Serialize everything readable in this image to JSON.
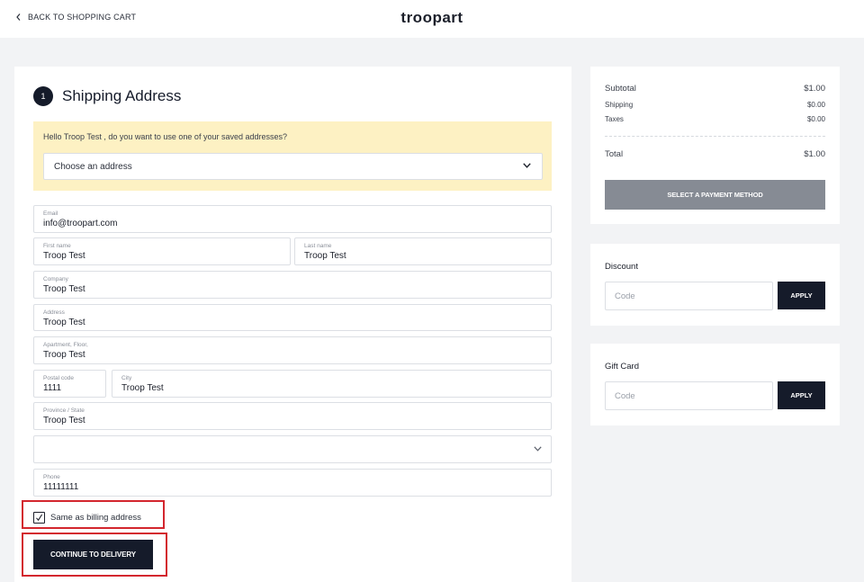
{
  "header": {
    "back_label": "BACK TO SHOPPING CART",
    "brand": "troopart"
  },
  "shipping": {
    "step_number": "1",
    "title": "Shipping Address",
    "saved_prompt": "Hello Troop Test , do you want to use one of your saved addresses?",
    "saved_select_value": "Choose an address",
    "fields": {
      "email": {
        "label": "Email",
        "value": "info@troopart.com"
      },
      "first_name": {
        "label": "First name",
        "value": "Troop Test"
      },
      "last_name": {
        "label": "Last name",
        "value": "Troop Test"
      },
      "company": {
        "label": "Company",
        "value": "Troop Test"
      },
      "address": {
        "label": "Address",
        "value": "Troop Test"
      },
      "apartment": {
        "label": "Apartment, Floor,",
        "value": "Troop Test"
      },
      "postal_code": {
        "label": "Postal code",
        "value": "1111"
      },
      "city": {
        "label": "City",
        "value": "Troop Test"
      },
      "province": {
        "label": "Province / State",
        "value": "Troop Test"
      },
      "country": {
        "value": ""
      },
      "phone": {
        "label": "Phone",
        "value": "11111111"
      }
    },
    "billing_checkbox_label": "Same as billing address",
    "billing_checked": true,
    "continue_label": "CONTINUE TO DELIVERY"
  },
  "summary": {
    "subtotal_label": "Subtotal",
    "subtotal_value": "$1.00",
    "shipping_label": "Shipping",
    "shipping_value": "$0.00",
    "taxes_label": "Taxes",
    "taxes_value": "$0.00",
    "total_label": "Total",
    "total_value": "$1.00",
    "payment_button": "SELECT A PAYMENT METHOD"
  },
  "discount": {
    "title": "Discount",
    "placeholder": "Code",
    "apply_label": "APPLY"
  },
  "gift_card": {
    "title": "Gift Card",
    "placeholder": "Code",
    "apply_label": "APPLY"
  },
  "colors": {
    "primary_dark": "#151b2a",
    "highlight_red": "#d3262e",
    "saved_box_bg": "#fdf1c3",
    "disabled_button": "#868b94"
  }
}
